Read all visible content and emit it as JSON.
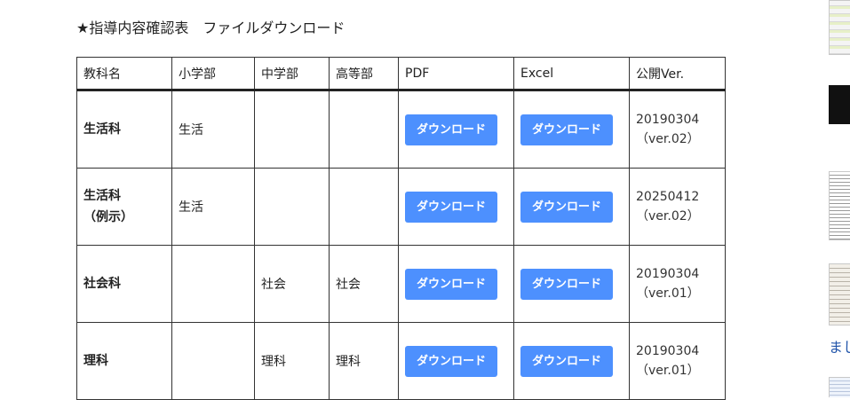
{
  "heading": "★指導内容確認表　ファイルダウンロード",
  "table": {
    "columns": [
      "教科名",
      "小学部",
      "中学部",
      "高等部",
      "PDF",
      "Excel",
      "公開Ver."
    ],
    "button_label": "ダウンロード",
    "rows": [
      {
        "subject": "生活科",
        "elementary": "生活",
        "junior": "",
        "senior": "",
        "version_date": "20190304",
        "version_num": "（ver.02）"
      },
      {
        "subject": "生活科\n（例示）",
        "elementary": "生活",
        "junior": "",
        "senior": "",
        "version_date": "20250412",
        "version_num": "（ver.02）"
      },
      {
        "subject": "社会科",
        "elementary": "",
        "junior": "社会",
        "senior": "社会",
        "version_date": "20190304",
        "version_num": "（ver.01）"
      },
      {
        "subject": "理科",
        "elementary": "",
        "junior": "理科",
        "senior": "理科",
        "version_date": "20190304",
        "version_num": "（ver.01）"
      }
    ]
  },
  "sidebar": {
    "link_text": "まし"
  }
}
